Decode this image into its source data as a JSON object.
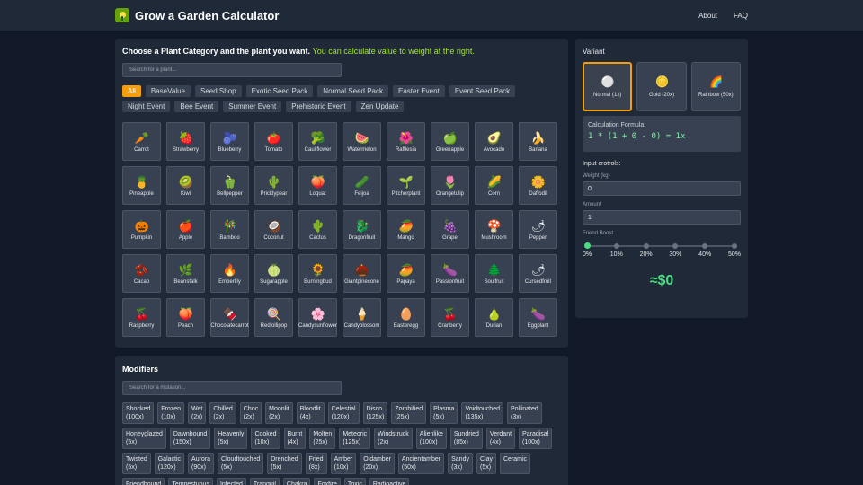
{
  "header": {
    "title": "Grow a Garden Calculator",
    "nav": [
      "About",
      "FAQ"
    ]
  },
  "plants_panel": {
    "title": "Choose a Plant Category and the plant you want.",
    "title_highlight": "You can calculate value to weight at the right.",
    "search_placeholder": "Search for a plant...",
    "categories": [
      {
        "label": "All",
        "active": true
      },
      {
        "label": "BaseValue",
        "active": false
      },
      {
        "label": "Seed Shop",
        "active": false
      },
      {
        "label": "Exotic Seed Pack",
        "active": false
      },
      {
        "label": "Normal Seed Pack",
        "active": false
      },
      {
        "label": "Easter Event",
        "active": false
      },
      {
        "label": "Event Seed Pack",
        "active": false
      },
      {
        "label": "Night Event",
        "active": false
      },
      {
        "label": "Bee Event",
        "active": false
      },
      {
        "label": "Summer Event",
        "active": false
      },
      {
        "label": "Prehistoric Event",
        "active": false
      },
      {
        "label": "Zen Update",
        "active": false
      }
    ],
    "plants": [
      {
        "name": "Carrot",
        "icon": "carrot-icon",
        "glyph": "🥕"
      },
      {
        "name": "Strawberry",
        "icon": "strawberry-icon",
        "glyph": "🍓"
      },
      {
        "name": "Blueberry",
        "icon": "blueberry-icon",
        "glyph": "🫐"
      },
      {
        "name": "Tomato",
        "icon": "tomato-icon",
        "glyph": "🍅"
      },
      {
        "name": "Cauliflower",
        "icon": "cauliflower-icon",
        "glyph": "🥦"
      },
      {
        "name": "Watermelon",
        "icon": "watermelon-icon",
        "glyph": "🍉"
      },
      {
        "name": "Rafflesia",
        "icon": "rafflesia-icon",
        "glyph": "🌺"
      },
      {
        "name": "Greenapple",
        "icon": "greenapple-icon",
        "glyph": "🍏"
      },
      {
        "name": "Avocado",
        "icon": "avocado-icon",
        "glyph": "🥑"
      },
      {
        "name": "Banana",
        "icon": "banana-icon",
        "glyph": "🍌"
      },
      {
        "name": "Pineapple",
        "icon": "pineapple-icon",
        "glyph": "🍍"
      },
      {
        "name": "Kiwi",
        "icon": "kiwi-icon",
        "glyph": "🥝"
      },
      {
        "name": "Bellpepper",
        "icon": "bellpepper-icon",
        "glyph": "🫑"
      },
      {
        "name": "Pricklypear",
        "icon": "pricklypear-icon",
        "glyph": "🌵"
      },
      {
        "name": "Loquat",
        "icon": "loquat-icon",
        "glyph": "🍑"
      },
      {
        "name": "Feijoa",
        "icon": "feijoa-icon",
        "glyph": "🥒"
      },
      {
        "name": "Pitcherplant",
        "icon": "pitcherplant-icon",
        "glyph": "🌱"
      },
      {
        "name": "Orangetulip",
        "icon": "orangetulip-icon",
        "glyph": "🌷"
      },
      {
        "name": "Corn",
        "icon": "corn-icon",
        "glyph": "🌽"
      },
      {
        "name": "Daffodil",
        "icon": "daffodil-icon",
        "glyph": "🌼"
      },
      {
        "name": "Pumpkin",
        "icon": "pumpkin-icon",
        "glyph": "🎃"
      },
      {
        "name": "Apple",
        "icon": "apple-icon",
        "glyph": "🍎"
      },
      {
        "name": "Bamboo",
        "icon": "bamboo-icon",
        "glyph": "🎋"
      },
      {
        "name": "Coconut",
        "icon": "coconut-icon",
        "glyph": "🥥"
      },
      {
        "name": "Cactus",
        "icon": "cactus-icon",
        "glyph": "🌵"
      },
      {
        "name": "Dragonfruit",
        "icon": "dragonfruit-icon",
        "glyph": "🐉"
      },
      {
        "name": "Mango",
        "icon": "mango-icon",
        "glyph": "🥭"
      },
      {
        "name": "Grape",
        "icon": "grape-icon",
        "glyph": "🍇"
      },
      {
        "name": "Mushroom",
        "icon": "mushroom-icon",
        "glyph": "🍄"
      },
      {
        "name": "Pepper",
        "icon": "pepper-icon",
        "glyph": "🌶"
      },
      {
        "name": "Cacao",
        "icon": "cacao-icon",
        "glyph": "🫘"
      },
      {
        "name": "Beanstalk",
        "icon": "beanstalk-icon",
        "glyph": "🌿"
      },
      {
        "name": "Emberlily",
        "icon": "emberlily-icon",
        "glyph": "🔥"
      },
      {
        "name": "Sugarapple",
        "icon": "sugarapple-icon",
        "glyph": "🍈"
      },
      {
        "name": "Burningbud",
        "icon": "burningbud-icon",
        "glyph": "🌻"
      },
      {
        "name": "Giantpinecone",
        "icon": "giantpinecone-icon",
        "glyph": "🌰"
      },
      {
        "name": "Papaya",
        "icon": "papaya-icon",
        "glyph": "🥭"
      },
      {
        "name": "Passionfruit",
        "icon": "passionfruit-icon",
        "glyph": "🍆"
      },
      {
        "name": "Soulfruit",
        "icon": "soulfruit-icon",
        "glyph": "🌲"
      },
      {
        "name": "Cursedfruit",
        "icon": "cursedfruit-icon",
        "glyph": "🌶"
      },
      {
        "name": "Raspberry",
        "icon": "raspberry-icon",
        "glyph": "🍒"
      },
      {
        "name": "Peach",
        "icon": "peach-icon",
        "glyph": "🍑"
      },
      {
        "name": "Chocolatecarrot",
        "icon": "chocolatecarrot-icon",
        "glyph": "🍫"
      },
      {
        "name": "Redlollipop",
        "icon": "redlollipop-icon",
        "glyph": "🍭"
      },
      {
        "name": "Candysunflower",
        "icon": "candysunflower-icon",
        "glyph": "🌸"
      },
      {
        "name": "Candyblossom",
        "icon": "candyblossom-icon",
        "glyph": "🍦"
      },
      {
        "name": "Easteregg",
        "icon": "easteregg-icon",
        "glyph": "🥚"
      },
      {
        "name": "Cranberry",
        "icon": "cranberry-icon",
        "glyph": "🍒"
      },
      {
        "name": "Durian",
        "icon": "durian-icon",
        "glyph": "🍐"
      },
      {
        "name": "Eggplant",
        "icon": "eggplant-icon",
        "glyph": "🍆"
      }
    ]
  },
  "calculator": {
    "variant_title": "Variant",
    "variants": [
      {
        "label": "Normal (1x)",
        "icon": "white-circle-icon",
        "glyph": "⚪",
        "selected": true
      },
      {
        "label": "Gold (20x)",
        "icon": "gold-coin-icon",
        "glyph": "🪙",
        "selected": false
      },
      {
        "label": "Rainbow (50x)",
        "icon": "rainbow-icon",
        "glyph": "🌈",
        "selected": false
      }
    ],
    "formula_label": "Calculation Formula:",
    "formula": "1 * (1 + 0 - 0) = 1x",
    "input_title": "Input crotrols:",
    "weight_label": "Weight (kg)",
    "weight_value": "0",
    "amount_label": "Amount",
    "amount_value": "1",
    "friend_boost_label": "Friend Boost",
    "friend_boost_options": [
      "0%",
      "10%",
      "20%",
      "30%",
      "40%",
      "50%"
    ],
    "friend_boost_selected_index": 0,
    "result": "≈$0"
  },
  "modifiers": {
    "title": "Modifiers",
    "search_placeholder": "Search for a mutation...",
    "items": [
      {
        "name": "Shocked",
        "mult": "(100x)"
      },
      {
        "name": "Frozen",
        "mult": "(10x)"
      },
      {
        "name": "Wet",
        "mult": "(2x)"
      },
      {
        "name": "Chilled",
        "mult": "(2x)"
      },
      {
        "name": "Choc",
        "mult": "(2x)"
      },
      {
        "name": "Moonlit",
        "mult": "(2x)"
      },
      {
        "name": "Bloodlit",
        "mult": "(4x)"
      },
      {
        "name": "Celestial",
        "mult": "(120x)"
      },
      {
        "name": "Disco",
        "mult": "(125x)"
      },
      {
        "name": "Zombified",
        "mult": "(25x)"
      },
      {
        "name": "Plasma",
        "mult": "(5x)"
      },
      {
        "name": "Voidtouched",
        "mult": "(135x)"
      },
      {
        "name": "Pollinated",
        "mult": "(3x)"
      },
      {
        "name": "Honeyglazed",
        "mult": "(5x)"
      },
      {
        "name": "Dawnbound",
        "mult": "(150x)"
      },
      {
        "name": "Heavenly",
        "mult": "(5x)"
      },
      {
        "name": "Cooked",
        "mult": "(10x)"
      },
      {
        "name": "Burnt",
        "mult": "(4x)"
      },
      {
        "name": "Molten",
        "mult": "(25x)"
      },
      {
        "name": "Meteoric",
        "mult": "(125x)"
      },
      {
        "name": "Windstruck",
        "mult": "(2x)"
      },
      {
        "name": "Alienlike",
        "mult": "(100x)"
      },
      {
        "name": "Sundried",
        "mult": "(85x)"
      },
      {
        "name": "Verdant",
        "mult": "(4x)"
      },
      {
        "name": "Paradisal",
        "mult": "(100x)"
      },
      {
        "name": "Twisted",
        "mult": "(5x)"
      },
      {
        "name": "Galactic",
        "mult": "(120x)"
      },
      {
        "name": "Aurora",
        "mult": "(90x)"
      },
      {
        "name": "Cloudtouched",
        "mult": "(5x)"
      },
      {
        "name": "Drenched",
        "mult": "(5x)"
      },
      {
        "name": "Fried",
        "mult": "(8x)"
      },
      {
        "name": "Amber",
        "mult": "(10x)"
      },
      {
        "name": "Oldamber",
        "mult": "(20x)"
      },
      {
        "name": "Ancientamber",
        "mult": "(50x)"
      },
      {
        "name": "Sandy",
        "mult": "(3x)"
      },
      {
        "name": "Clay",
        "mult": "(5x)"
      },
      {
        "name": "Ceramic",
        "mult": ""
      },
      {
        "name": "Friendbound",
        "mult": ""
      },
      {
        "name": "Tempestuous",
        "mult": ""
      },
      {
        "name": "Infected",
        "mult": ""
      },
      {
        "name": "Tranquil",
        "mult": ""
      },
      {
        "name": "Chakra",
        "mult": ""
      },
      {
        "name": "Foxfire",
        "mult": ""
      },
      {
        "name": "Toxic",
        "mult": ""
      },
      {
        "name": "Radioactive",
        "mult": ""
      }
    ]
  },
  "colors": {
    "accent": "#f59e0b",
    "highlight": "#a3e635",
    "result": "#4ade80",
    "background": "#111827",
    "panel": "#1f2937"
  }
}
